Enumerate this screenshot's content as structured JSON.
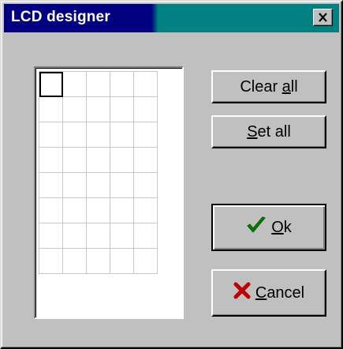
{
  "window": {
    "title": "LCD designer",
    "title_active_color": "#000080",
    "title_accent_color": "#008080",
    "close_icon": "close-icon"
  },
  "grid": {
    "columns": 5,
    "rows": 8,
    "selected_cell": [
      0,
      0
    ]
  },
  "buttons": {
    "clear_all": {
      "pre": "Clear ",
      "accel": "a",
      "post": "ll"
    },
    "set_all": {
      "pre": "",
      "accel": "S",
      "post": "et all"
    },
    "ok": {
      "pre": "",
      "accel": "O",
      "post": "k",
      "icon": "checkmark-icon",
      "icon_color": "#008000"
    },
    "cancel": {
      "pre": "",
      "accel": "C",
      "post": "ancel",
      "icon": "x-cross-icon",
      "icon_color": "#c00000"
    }
  }
}
